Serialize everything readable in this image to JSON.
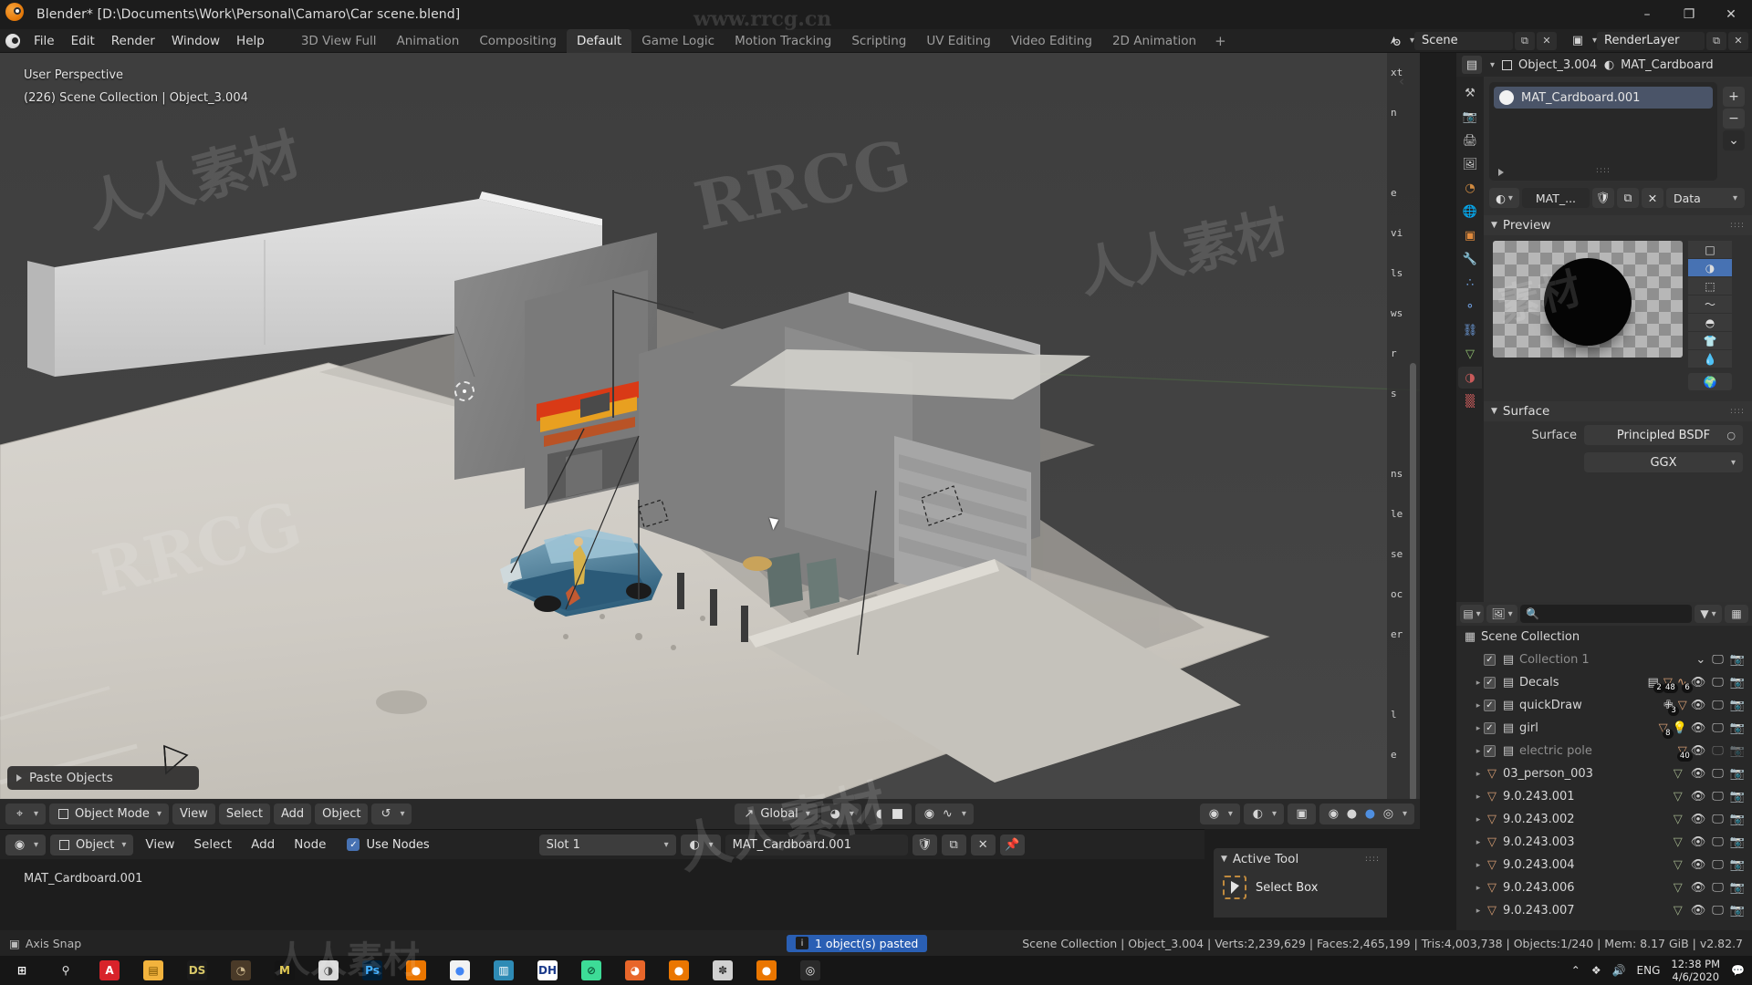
{
  "window": {
    "title": "Blender* [D:\\Documents\\Work\\Personal\\Camaro\\Car scene.blend]",
    "minimize": "–",
    "maximize": "❐",
    "close": "✕"
  },
  "topbar": {
    "menus": [
      "File",
      "Edit",
      "Render",
      "Window",
      "Help"
    ],
    "workspaces": [
      {
        "label": "3D View Full",
        "active": false
      },
      {
        "label": "Animation",
        "active": false
      },
      {
        "label": "Compositing",
        "active": false
      },
      {
        "label": "Default",
        "active": true
      },
      {
        "label": "Game Logic",
        "active": false
      },
      {
        "label": "Motion Tracking",
        "active": false
      },
      {
        "label": "Scripting",
        "active": false
      },
      {
        "label": "UV Editing",
        "active": false
      },
      {
        "label": "Video Editing",
        "active": false
      },
      {
        "label": "2D Animation",
        "active": false
      }
    ],
    "add_workspace": "+",
    "scene_name": "Scene",
    "view_layer_name": "RenderLayer",
    "new_scene_icon": "copy-icon",
    "new_layer_icon": "copy-icon"
  },
  "viewport": {
    "perspective_label": "User Perspective",
    "scene_info": "(226) Scene Collection | Object_3.004",
    "operator_panel": "Paste Objects",
    "collapse_icon": "chevron-left-icon",
    "sidebar_rows": [
      "xt",
      "n",
      "",
      "e",
      "vi",
      "ls",
      "ws",
      "r",
      "s",
      "",
      "ns",
      "le",
      "se",
      "oc",
      "er",
      "",
      "l",
      "e"
    ]
  },
  "view3d_header": {
    "editor_type": "editor-type-icon",
    "mode": "Object Mode",
    "menus": [
      "View",
      "Select",
      "Add",
      "Object"
    ],
    "transform_orientation": "Global",
    "snap_icon": "magnet-icon",
    "proportional_icon": "proportional-edit-icon",
    "overlay_icon": "overlays-icon",
    "xray_icon": "xray-icon",
    "shading_modes": [
      "wireframe",
      "solid",
      "material-preview",
      "rendered"
    ],
    "active_shading": "material-preview"
  },
  "node_editor": {
    "editor_icon": "shader-editor-icon",
    "shader_type": "Object",
    "menus": [
      "View",
      "Select",
      "Add",
      "Node"
    ],
    "use_nodes_label": "Use Nodes",
    "use_nodes_checked": true,
    "slot": "Slot 1",
    "material_name": "MAT_Cardboard.001",
    "browse_icon": "material-icon",
    "fake_user_icon": "shield-icon",
    "copy_icon": "duplicate-icon",
    "unlink_icon": "x-icon",
    "pin_icon": "pin-icon",
    "body_label": "MAT_Cardboard.001"
  },
  "active_tool": {
    "title": "Active Tool",
    "tool_name": "Select Box",
    "grip": "::::"
  },
  "properties": {
    "breadcrumb_object": "Object_3.004",
    "breadcrumb_material": "MAT_Cardboard",
    "editor_icon": "properties-editor-icon",
    "tabs": [
      {
        "name": "tool",
        "icon": "wrench-screwdriver-icon",
        "active": false
      },
      {
        "name": "render",
        "icon": "camera-back-icon",
        "active": false
      },
      {
        "name": "output",
        "icon": "printer-icon",
        "active": false
      },
      {
        "name": "view-layer",
        "icon": "images-icon",
        "active": false
      },
      {
        "name": "scene",
        "icon": "cone-sphere-icon",
        "active": false
      },
      {
        "name": "world",
        "icon": "world-icon",
        "active": false
      },
      {
        "name": "object",
        "icon": "orange-square-icon",
        "active": false
      },
      {
        "name": "modifiers",
        "icon": "wrench-icon",
        "active": false
      },
      {
        "name": "particles",
        "icon": "particles-icon",
        "active": false
      },
      {
        "name": "physics",
        "icon": "physics-orbit-icon",
        "active": false
      },
      {
        "name": "constraints",
        "icon": "constraint-icon",
        "active": false
      },
      {
        "name": "data",
        "icon": "green-triangle-data-icon",
        "active": false
      },
      {
        "name": "material",
        "icon": "material-sphere-icon",
        "active": true
      },
      {
        "name": "texture",
        "icon": "checker-texture-icon",
        "active": false
      }
    ],
    "material_slot": {
      "name": "MAT_Cardboard.001",
      "add_label": "+",
      "remove_label": "−",
      "menu_label": "⌄"
    },
    "datablock": {
      "browse_icon": "material-icon",
      "name": "MAT_...",
      "shield_icon": "fake-user-shield-icon",
      "copy_icon": "new-material-icon",
      "unlink_icon": "x-icon",
      "link_mode": "Data"
    },
    "preview": {
      "title": "Preview",
      "grip": "::::",
      "shapes": [
        {
          "name": "plane",
          "active": false
        },
        {
          "name": "sphere",
          "active": true
        },
        {
          "name": "cube",
          "active": false
        },
        {
          "name": "hair",
          "active": false
        },
        {
          "name": "shader-ball",
          "active": false
        },
        {
          "name": "cloth",
          "active": false
        },
        {
          "name": "fluid",
          "active": false
        }
      ],
      "world_toggle": {
        "name": "world-preview",
        "active": false
      }
    },
    "surface": {
      "title": "Surface",
      "grip": "::::",
      "surface_label": "Surface",
      "surface_value": "Principled BSDF",
      "distribution_value": "GGX"
    }
  },
  "outliner": {
    "display_mode_icon": "view-layer-icon",
    "filter_icon": "funnel-icon",
    "search_placeholder": "",
    "search_icon": "search-icon",
    "new_collection_icon": "new-collection-icon",
    "root": "Scene Collection",
    "rows": [
      {
        "name": "Collection 1",
        "type": "collection",
        "dim": true,
        "checked": true,
        "indent": 1,
        "badges": [],
        "visible_icon": "chevron-down",
        "screen": true,
        "camera": true,
        "expand": false
      },
      {
        "name": "Decals",
        "type": "collection",
        "dim": false,
        "checked": true,
        "indent": 1,
        "badges": [
          {
            "icon": "collection",
            "count": "2"
          },
          {
            "icon": "mesh",
            "count": "48"
          },
          {
            "icon": "curve",
            "count": "6"
          }
        ],
        "visible_icon": "eye",
        "screen": true,
        "camera": true,
        "expand": true
      },
      {
        "name": "quickDraw",
        "type": "collection",
        "dim": false,
        "checked": true,
        "indent": 1,
        "badges": [
          {
            "icon": "empty",
            "count": "3"
          },
          {
            "icon": "mesh",
            "count": ""
          }
        ],
        "visible_icon": "eye",
        "screen": true,
        "camera": true,
        "expand": true
      },
      {
        "name": "girl",
        "type": "collection",
        "dim": false,
        "checked": true,
        "indent": 1,
        "badges": [
          {
            "icon": "mesh",
            "count": "8"
          },
          {
            "icon": "light",
            "count": ""
          }
        ],
        "visible_icon": "eye",
        "screen": true,
        "camera": true,
        "expand": true
      },
      {
        "name": "electric pole",
        "type": "collection",
        "dim": true,
        "checked": true,
        "indent": 1,
        "badges": [
          {
            "icon": "mesh",
            "count": "40"
          }
        ],
        "visible_icon": "eye",
        "screen": false,
        "camera": false,
        "expand": true
      },
      {
        "name": "03_person_003",
        "type": "mesh",
        "dim": false,
        "checked": null,
        "indent": 1,
        "badges": [],
        "visible_icon": "eye",
        "screen": true,
        "camera": true,
        "expand": true
      },
      {
        "name": "9.0.243.001",
        "type": "mesh",
        "dim": false,
        "checked": null,
        "indent": 1,
        "badges": [],
        "visible_icon": "eye",
        "screen": true,
        "camera": true,
        "expand": true
      },
      {
        "name": "9.0.243.002",
        "type": "mesh",
        "dim": false,
        "checked": null,
        "indent": 1,
        "badges": [],
        "visible_icon": "eye",
        "screen": true,
        "camera": true,
        "expand": true
      },
      {
        "name": "9.0.243.003",
        "type": "mesh",
        "dim": false,
        "checked": null,
        "indent": 1,
        "badges": [],
        "visible_icon": "eye",
        "screen": true,
        "camera": true,
        "expand": true
      },
      {
        "name": "9.0.243.004",
        "type": "mesh",
        "dim": false,
        "checked": null,
        "indent": 1,
        "badges": [],
        "visible_icon": "eye",
        "screen": true,
        "camera": true,
        "expand": true
      },
      {
        "name": "9.0.243.006",
        "type": "mesh",
        "dim": false,
        "checked": null,
        "indent": 1,
        "badges": [],
        "visible_icon": "eye",
        "screen": true,
        "camera": true,
        "expand": true
      },
      {
        "name": "9.0.243.007",
        "type": "mesh",
        "dim": false,
        "checked": null,
        "indent": 1,
        "badges": [],
        "visible_icon": "eye",
        "screen": true,
        "camera": true,
        "expand": true
      }
    ]
  },
  "statusbar": {
    "keymap_hint": "Axis Snap",
    "report": "1 object(s) pasted",
    "report_icon": "info-icon",
    "stats": "Scene Collection | Object_3.004 | Verts:2,239,629 | Faces:2,465,199 | Tris:4,003,738 | Objects:1/240 | Mem: 8.17 GiB | v2.82.7"
  },
  "taskbar": {
    "items": [
      {
        "name": "start-button",
        "glyph": "⊞",
        "bg": "transparent",
        "fg": "#ffffff"
      },
      {
        "name": "search-icon",
        "glyph": "⚲",
        "bg": "transparent",
        "fg": "#e8e8e8"
      },
      {
        "name": "pdf-app",
        "glyph": "A",
        "bg": "#d8232a",
        "fg": "#ffffff"
      },
      {
        "name": "file-explorer",
        "glyph": "▤",
        "bg": "#f2b33d",
        "fg": "#7a5200"
      },
      {
        "name": "daz-studio",
        "glyph": "DS",
        "bg": "#1b1b1b",
        "fg": "#d7c768"
      },
      {
        "name": "zbrush",
        "glyph": "◔",
        "bg": "#4a3a28",
        "fg": "#c9b48a"
      },
      {
        "name": "marmoset",
        "glyph": "M",
        "bg": "#141414",
        "fg": "#e0c74a"
      },
      {
        "name": "substance",
        "glyph": "◑",
        "bg": "#d9d9d9",
        "fg": "#4a4a4a"
      },
      {
        "name": "photoshop",
        "glyph": "Ps",
        "bg": "#001e36",
        "fg": "#31a8ff"
      },
      {
        "name": "blender-taskbar",
        "glyph": "●",
        "bg": "#ea7600",
        "fg": "#ffffff"
      },
      {
        "name": "chrome",
        "glyph": "●",
        "bg": "#f2f2f2",
        "fg": "#4285f4"
      },
      {
        "name": "audio-app",
        "glyph": "▥",
        "bg": "#2e8bb5",
        "fg": "#ffffff"
      },
      {
        "name": "dh-app",
        "glyph": "DH",
        "bg": "#ffffff",
        "fg": "#1b3a8a"
      },
      {
        "name": "teal-app",
        "glyph": "⊘",
        "bg": "#3ddc97",
        "fg": "#0d5b3c"
      },
      {
        "name": "firefox",
        "glyph": "◕",
        "bg": "#e8662a",
        "fg": "#ffffff"
      },
      {
        "name": "blender-2",
        "glyph": "●",
        "bg": "#ea7600",
        "fg": "#ffffff"
      },
      {
        "name": "houdini",
        "glyph": "✽",
        "bg": "#d0d0d0",
        "fg": "#3a3a3a"
      },
      {
        "name": "blender-3",
        "glyph": "●",
        "bg": "#ea7600",
        "fg": "#ffffff"
      },
      {
        "name": "obs-studio",
        "glyph": "◎",
        "bg": "#2a2a2a",
        "fg": "#e8e8e8"
      }
    ],
    "tray": {
      "chevron": "⌃",
      "dropbox_icon": "dropbox-icon",
      "volume_icon": "ὐA",
      "language": "ENG",
      "time": "12:38 PM",
      "date": "4/6/2020",
      "notification_icon": "notification-icon"
    }
  },
  "watermarks": [
    "www.rrcg.cn",
    "RRCG",
    "人人素材"
  ],
  "colors": {
    "accent_blue": "#4772b3",
    "report_blue": "#2a5fb4",
    "orange": "#ea7600",
    "panel_bg": "#303030",
    "editor_bg": "#282828",
    "header_bg": "#232323"
  }
}
